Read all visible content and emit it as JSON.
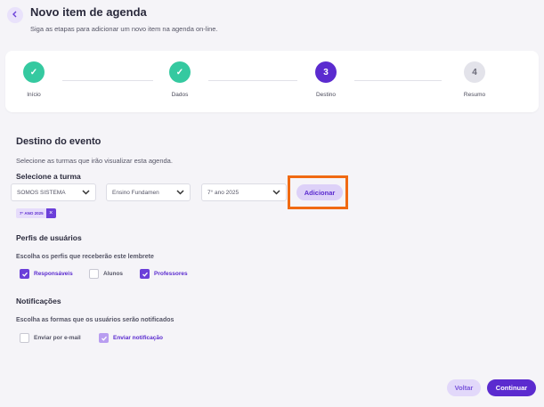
{
  "header": {
    "back_icon": "chevron-left-icon",
    "title": "Novo item de agenda",
    "subtitle": "Siga as etapas para adicionar um novo item na agenda on-line."
  },
  "stepper": {
    "steps": [
      {
        "label": "Início",
        "state": "done",
        "marker": "✓"
      },
      {
        "label": "Dados",
        "state": "done",
        "marker": "✓"
      },
      {
        "label": "Destino",
        "state": "current",
        "marker": "3"
      },
      {
        "label": "Resumo",
        "state": "pending",
        "marker": "4"
      }
    ]
  },
  "destino": {
    "title": "Destino do evento",
    "description": "Selecione as turmas que irão visualizar esta agenda.",
    "field_label": "Selecione a turma",
    "selects": [
      "SOMOS SISTEMA",
      "Ensino Fundamen",
      "7° ano 2025"
    ],
    "add_label": "Adicionar",
    "tag_label": "7° ANO 2025",
    "tag_remove": "×"
  },
  "perfis": {
    "title": "Perfis de usuários",
    "description": "Escolha os perfis que receberão este lembrete",
    "options": [
      {
        "label": "Responsáveis",
        "checked": true
      },
      {
        "label": "Alunos",
        "checked": false
      },
      {
        "label": "Professores",
        "checked": true
      }
    ]
  },
  "notificacoes": {
    "title": "Notificações",
    "description": "Escolha as formas que os usuários serão notificados",
    "options": [
      {
        "label": "Enviar por e-mail",
        "checked": false
      },
      {
        "label": "Enviar notificação",
        "checked": true
      }
    ]
  },
  "footer": {
    "back_label": "Voltar",
    "next_label": "Continuar"
  },
  "colors": {
    "primary": "#5b2bcf",
    "done": "#35c9a0",
    "highlight": "#f06a12"
  }
}
